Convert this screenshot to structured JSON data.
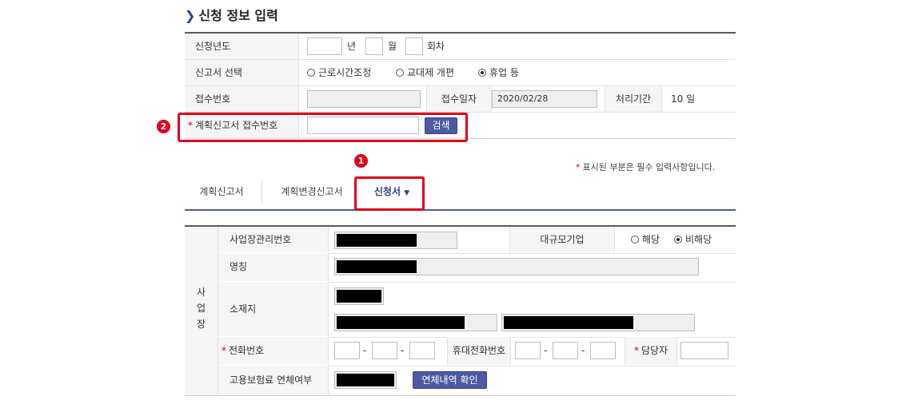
{
  "section_title": "신청 정보 입력",
  "form": {
    "year_label": "신청년도",
    "year_unit": "년",
    "month_unit": "월",
    "round_unit": "회차",
    "report_type_label": "신고서 선택",
    "report_options": [
      {
        "label": "근로시간조정",
        "selected": false
      },
      {
        "label": "교대제 개편",
        "selected": false
      },
      {
        "label": "휴업 등",
        "selected": true
      }
    ],
    "receipt_no_label": "접수번호",
    "receipt_date_label": "접수일자",
    "receipt_date_value": "2020/02/28",
    "processing_period_label": "처리기간",
    "processing_period_value": "10 일",
    "plan_receipt_label": "계획신고서 접수번호",
    "search_button": "검색"
  },
  "markers": {
    "one": "1",
    "two": "2"
  },
  "required_note": "표시된 부분은 필수 입력사항입니다.",
  "tabs": [
    {
      "label": "계획신고서",
      "active": false
    },
    {
      "label": "계획변경신고서",
      "active": false
    },
    {
      "label": "신청서",
      "active": true
    }
  ],
  "business": {
    "section_chars": [
      "사",
      "업",
      "장"
    ],
    "mgmt_no_label": "사업장관리번호",
    "large_company_label": "대규모기업",
    "large_company_options": [
      {
        "label": "해당",
        "selected": false
      },
      {
        "label": "비해당",
        "selected": true
      }
    ],
    "name_label": "명칭",
    "address_label": "소재지",
    "phone_label": "전화번호",
    "mobile_label": "휴대전화번호",
    "manager_label": "담당자",
    "phone_sep": "-",
    "insurance_label": "고용보험료 연체여부",
    "overdue_button": "연체내역 확인"
  },
  "colors": {
    "accent": "#4b5aa1",
    "highlight": "#e0001a",
    "required": "#d0001b"
  }
}
